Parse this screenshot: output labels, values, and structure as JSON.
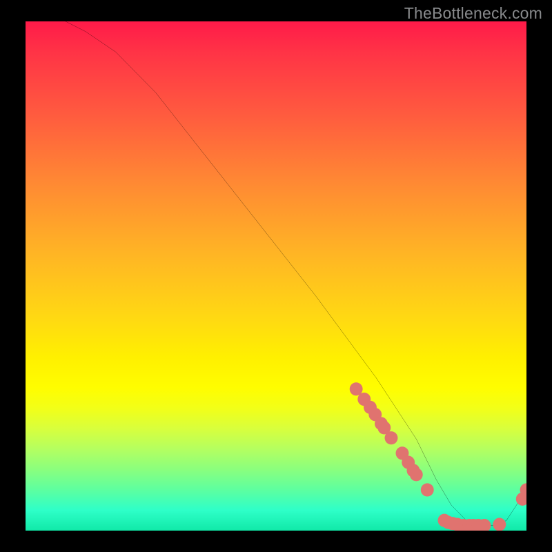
{
  "watermark": "TheBottleneck.com",
  "chart_data": {
    "type": "line",
    "title": "",
    "xlabel": "",
    "ylabel": "",
    "xlim": [
      0,
      100
    ],
    "ylim": [
      0,
      100
    ],
    "series": [
      {
        "name": "curve",
        "x": [
          0,
          4,
          8,
          12,
          18,
          26,
          34,
          42,
          50,
          58,
          64,
          70,
          74,
          78,
          80,
          82,
          85,
          88,
          90,
          92,
          94,
          96,
          98,
          100
        ],
        "y": [
          103,
          101.5,
          100,
          98,
          94,
          86,
          76,
          66,
          56,
          46,
          38,
          30,
          24,
          18,
          14,
          10,
          5,
          2,
          1,
          1,
          1,
          2,
          5,
          8
        ]
      }
    ],
    "markers": [
      {
        "x": 66.0,
        "y": 27.8
      },
      {
        "x": 67.6,
        "y": 25.8
      },
      {
        "x": 68.8,
        "y": 24.2
      },
      {
        "x": 69.8,
        "y": 22.8
      },
      {
        "x": 71.0,
        "y": 21.0
      },
      {
        "x": 71.6,
        "y": 20.2
      },
      {
        "x": 73.0,
        "y": 18.2
      },
      {
        "x": 75.2,
        "y": 15.2
      },
      {
        "x": 76.4,
        "y": 13.4
      },
      {
        "x": 77.4,
        "y": 11.8
      },
      {
        "x": 78.0,
        "y": 11.0
      },
      {
        "x": 80.2,
        "y": 8.0
      },
      {
        "x": 83.6,
        "y": 2.0
      },
      {
        "x": 84.4,
        "y": 1.6
      },
      {
        "x": 85.2,
        "y": 1.4
      },
      {
        "x": 86.2,
        "y": 1.2
      },
      {
        "x": 87.4,
        "y": 1.0
      },
      {
        "x": 88.6,
        "y": 1.0
      },
      {
        "x": 89.4,
        "y": 1.0
      },
      {
        "x": 90.4,
        "y": 1.0
      },
      {
        "x": 91.6,
        "y": 1.0
      },
      {
        "x": 94.6,
        "y": 1.2
      },
      {
        "x": 99.2,
        "y": 6.2
      },
      {
        "x": 100.0,
        "y": 8.0
      }
    ],
    "marker_radius": 1.3,
    "marker_color": "#e0736f",
    "line_color": "#000000",
    "line_width": 0.28
  }
}
